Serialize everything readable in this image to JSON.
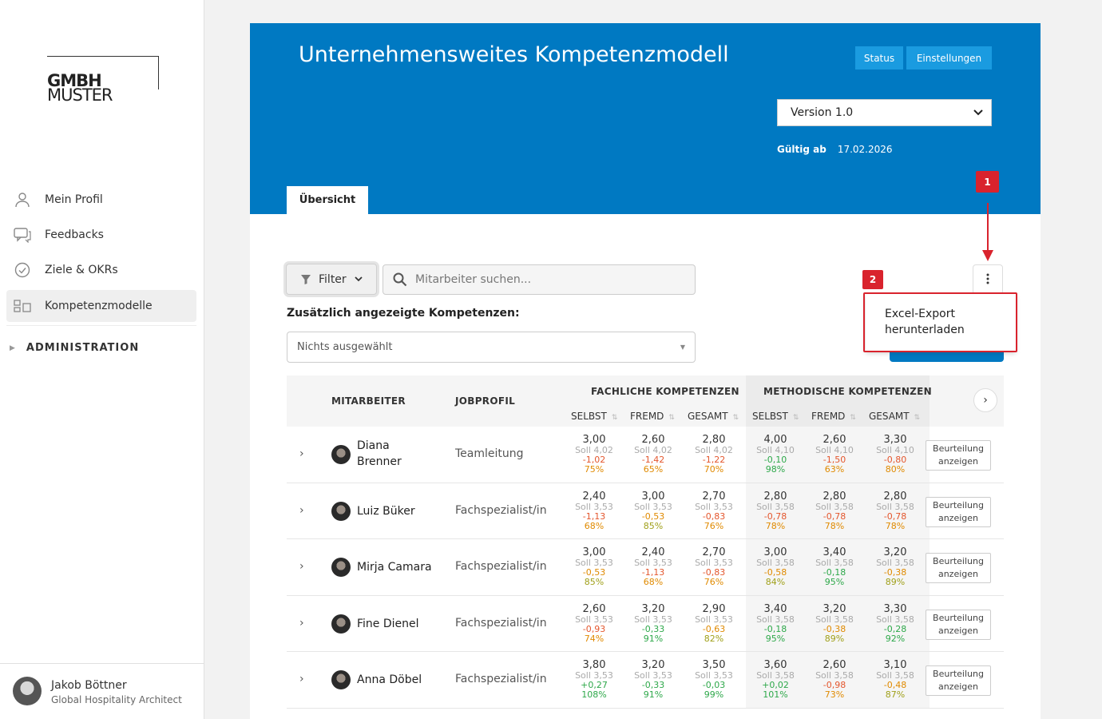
{
  "company": {
    "logo_light": "MUSTER",
    "logo_bold": "GMBH"
  },
  "sidebar": {
    "items": [
      {
        "label": "Mein Profil",
        "icon": "user-icon"
      },
      {
        "label": "Feedbacks",
        "icon": "chat-icon"
      },
      {
        "label": "Ziele & OKRs",
        "icon": "check-circle-icon"
      },
      {
        "label": "Kompetenzmodelle",
        "icon": "grid-icon"
      }
    ],
    "admin_label": "ADMINISTRATION"
  },
  "user": {
    "name": "Jakob Böttner",
    "role": "Global Hospitality Architect"
  },
  "header": {
    "title": "Unternehmensweites Kompetenzmodell",
    "status_label": "Status",
    "settings_label": "Einstellungen",
    "version_selected": "Version 1.0",
    "valid_from_label": "Gültig ab",
    "valid_from_date": "17.02.2026",
    "tab_label": "Übersicht"
  },
  "toolbar": {
    "filter_label": "Filter",
    "search_placeholder": "Mitarbeiter suchen...",
    "extra_label": "Zusätzlich angezeigte Kompetenzen:",
    "extra_value": "Nichts ausgewählt"
  },
  "menu": {
    "export_line1": "Excel-Export",
    "export_line2": "herunterladen"
  },
  "annotations": {
    "badge1": "1",
    "badge2": "2",
    "color": "#d9232d"
  },
  "table": {
    "col_employee": "MITARBEITER",
    "col_jobprofile": "JOBPROFIL",
    "group_fach": "FACHLICHE KOMPETENZEN",
    "group_meth": "METHODISCHE KOMPETENZEN",
    "sub_selbst": "SELBST",
    "sub_fremd": "FREMD",
    "sub_gesamt": "GESAMT",
    "action_line1": "Beurteilung",
    "action_line2": "anzeigen",
    "rows": [
      {
        "name": "Diana Brenner",
        "job": "Teamleitung",
        "cells": [
          {
            "v": "3,00",
            "soll": "Soll 4,02",
            "d": "-1,02",
            "dc": "c-red",
            "p": "75%",
            "pc": "c-orange"
          },
          {
            "v": "2,60",
            "soll": "Soll 4,02",
            "d": "-1,42",
            "dc": "c-red",
            "p": "65%",
            "pc": "c-orange"
          },
          {
            "v": "2,80",
            "soll": "Soll 4,02",
            "d": "-1,22",
            "dc": "c-red",
            "p": "70%",
            "pc": "c-orange"
          },
          {
            "v": "4,00",
            "soll": "Soll 4,10",
            "d": "-0,10",
            "dc": "c-green",
            "p": "98%",
            "pc": "c-green"
          },
          {
            "v": "2,60",
            "soll": "Soll 4,10",
            "d": "-1,50",
            "dc": "c-red",
            "p": "63%",
            "pc": "c-orange"
          },
          {
            "v": "3,30",
            "soll": "Soll 4,10",
            "d": "-0,80",
            "dc": "c-red",
            "p": "80%",
            "pc": "c-orange"
          }
        ]
      },
      {
        "name": "Luiz Büker",
        "job": "Fachspezialist/in",
        "cells": [
          {
            "v": "2,40",
            "soll": "Soll 3,53",
            "d": "-1,13",
            "dc": "c-red",
            "p": "68%",
            "pc": "c-orange"
          },
          {
            "v": "3,00",
            "soll": "Soll 3,53",
            "d": "-0,53",
            "dc": "c-orange",
            "p": "85%",
            "pc": "c-olive"
          },
          {
            "v": "2,70",
            "soll": "Soll 3,53",
            "d": "-0,83",
            "dc": "c-red",
            "p": "76%",
            "pc": "c-orange"
          },
          {
            "v": "2,80",
            "soll": "Soll 3,58",
            "d": "-0,78",
            "dc": "c-red",
            "p": "78%",
            "pc": "c-orange"
          },
          {
            "v": "2,80",
            "soll": "Soll 3,58",
            "d": "-0,78",
            "dc": "c-red",
            "p": "78%",
            "pc": "c-orange"
          },
          {
            "v": "2,80",
            "soll": "Soll 3,58",
            "d": "-0,78",
            "dc": "c-red",
            "p": "78%",
            "pc": "c-orange"
          }
        ]
      },
      {
        "name": "Mirja Camara",
        "job": "Fachspezialist/in",
        "cells": [
          {
            "v": "3,00",
            "soll": "Soll 3,53",
            "d": "-0,53",
            "dc": "c-orange",
            "p": "85%",
            "pc": "c-olive"
          },
          {
            "v": "2,40",
            "soll": "Soll 3,53",
            "d": "-1,13",
            "dc": "c-red",
            "p": "68%",
            "pc": "c-orange"
          },
          {
            "v": "2,70",
            "soll": "Soll 3,53",
            "d": "-0,83",
            "dc": "c-red",
            "p": "76%",
            "pc": "c-orange"
          },
          {
            "v": "3,00",
            "soll": "Soll 3,58",
            "d": "-0,58",
            "dc": "c-orange",
            "p": "84%",
            "pc": "c-olive"
          },
          {
            "v": "3,40",
            "soll": "Soll 3,58",
            "d": "-0,18",
            "dc": "c-green",
            "p": "95%",
            "pc": "c-green"
          },
          {
            "v": "3,20",
            "soll": "Soll 3,58",
            "d": "-0,38",
            "dc": "c-orange",
            "p": "89%",
            "pc": "c-olive"
          }
        ]
      },
      {
        "name": "Fine Dienel",
        "job": "Fachspezialist/in",
        "cells": [
          {
            "v": "2,60",
            "soll": "Soll 3,53",
            "d": "-0,93",
            "dc": "c-red",
            "p": "74%",
            "pc": "c-orange"
          },
          {
            "v": "3,20",
            "soll": "Soll 3,53",
            "d": "-0,33",
            "dc": "c-green",
            "p": "91%",
            "pc": "c-green"
          },
          {
            "v": "2,90",
            "soll": "Soll 3,53",
            "d": "-0,63",
            "dc": "c-orange",
            "p": "82%",
            "pc": "c-olive"
          },
          {
            "v": "3,40",
            "soll": "Soll 3,58",
            "d": "-0,18",
            "dc": "c-green",
            "p": "95%",
            "pc": "c-green"
          },
          {
            "v": "3,20",
            "soll": "Soll 3,58",
            "d": "-0,38",
            "dc": "c-orange",
            "p": "89%",
            "pc": "c-olive"
          },
          {
            "v": "3,30",
            "soll": "Soll 3,58",
            "d": "-0,28",
            "dc": "c-green",
            "p": "92%",
            "pc": "c-green"
          }
        ]
      },
      {
        "name": "Anna Döbel",
        "job": "Fachspezialist/in",
        "cells": [
          {
            "v": "3,80",
            "soll": "Soll 3,53",
            "d": "+0,27",
            "dc": "c-green",
            "p": "108%",
            "pc": "c-green"
          },
          {
            "v": "3,20",
            "soll": "Soll 3,53",
            "d": "-0,33",
            "dc": "c-green",
            "p": "91%",
            "pc": "c-green"
          },
          {
            "v": "3,50",
            "soll": "Soll 3,53",
            "d": "-0,03",
            "dc": "c-green",
            "p": "99%",
            "pc": "c-green"
          },
          {
            "v": "3,60",
            "soll": "Soll 3,58",
            "d": "+0,02",
            "dc": "c-green",
            "p": "101%",
            "pc": "c-green"
          },
          {
            "v": "2,60",
            "soll": "Soll 3,58",
            "d": "-0,98",
            "dc": "c-red",
            "p": "73%",
            "pc": "c-orange"
          },
          {
            "v": "3,10",
            "soll": "Soll 3,58",
            "d": "-0,48",
            "dc": "c-orange",
            "p": "87%",
            "pc": "c-olive"
          }
        ]
      }
    ]
  }
}
